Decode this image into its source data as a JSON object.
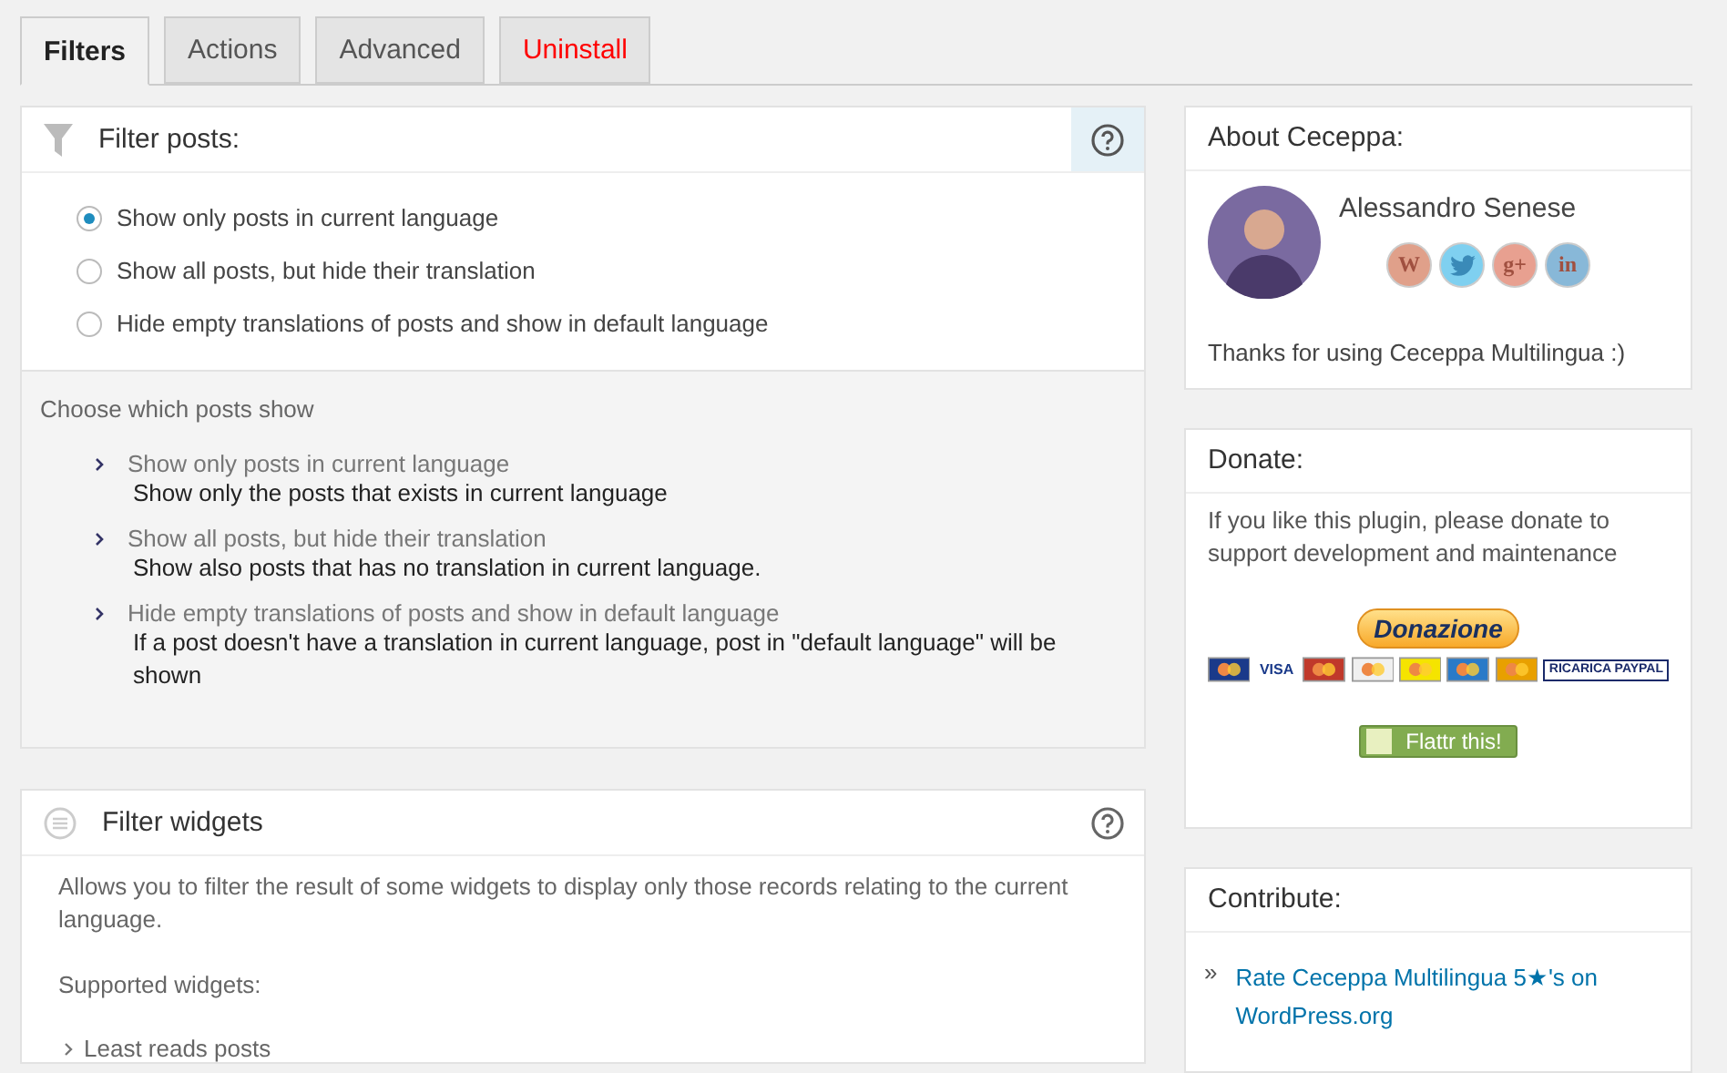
{
  "tabs": [
    {
      "label": "Filters",
      "selected": true,
      "kind": "normal"
    },
    {
      "label": "Actions",
      "selected": false,
      "kind": "normal"
    },
    {
      "label": "Advanced",
      "selected": false,
      "kind": "normal"
    },
    {
      "label": "Uninstall",
      "selected": false,
      "kind": "danger"
    }
  ],
  "filter_posts": {
    "title": "Filter posts:",
    "options": [
      {
        "label": "Show only posts in current language",
        "selected": true
      },
      {
        "label": "Show all posts, but hide their translation",
        "selected": false
      },
      {
        "label": "Hide empty translations of posts and show in default language",
        "selected": false
      }
    ],
    "help": {
      "intro": "Choose which posts show",
      "items": [
        {
          "term": "Show only posts in current language",
          "description": "Show only the posts that exists in current language"
        },
        {
          "term": "Show all posts, but hide their translation",
          "description": "Show also posts that has no translation in current language."
        },
        {
          "term": "Hide empty translations of posts and show in default language",
          "description": "If a post doesn't have a translation in current language, post in \"default language\" will be shown"
        }
      ]
    }
  },
  "filter_widgets": {
    "title": "Filter widgets",
    "description": "Allows you to filter the result of some widgets to display only those records relating to the current language.",
    "supported_label": "Supported widgets:",
    "widgets": [
      "Least reads posts"
    ]
  },
  "about": {
    "title": "About Ceceppa:",
    "name": "Alessandro Senese",
    "social": [
      {
        "kind": "text",
        "label": "W",
        "color": "#e0a08a"
      },
      {
        "kind": "bird",
        "color": "#7fd0f0"
      },
      {
        "kind": "text",
        "label": "g+",
        "color": "#e8a090"
      },
      {
        "kind": "text",
        "label": "in",
        "color": "#88b8d8"
      }
    ],
    "thanks": "Thanks for using Ceceppa Multilingua :)"
  },
  "donate": {
    "title": "Donate:",
    "text": "If you like this plugin, please donate to support development and maintenance",
    "button": "Donazione",
    "cards": [
      {
        "kind": "logo",
        "color": "#1a3a8a"
      },
      {
        "kind": "text",
        "label": "VISA",
        "color": "#1a3a8a"
      },
      {
        "kind": "logo",
        "color": "#c0392b"
      },
      {
        "kind": "logo",
        "color": "#f0f0f0"
      },
      {
        "kind": "logo",
        "color": "#f5e400"
      },
      {
        "kind": "logo",
        "color": "#2a7ac8"
      },
      {
        "kind": "logo",
        "color": "#e8a000"
      },
      {
        "kind": "text",
        "label": "RICARICA PAYPAL",
        "color": "#1a2a6a"
      }
    ],
    "flattr": "Flattr this!"
  },
  "contribute": {
    "title": "Contribute:",
    "items": [
      {
        "bullet": "»",
        "link": "Rate Ceceppa Multilingua 5★'s on WordPress.org"
      }
    ]
  }
}
